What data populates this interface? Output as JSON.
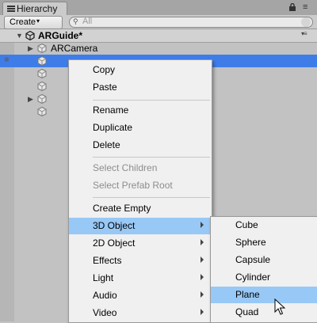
{
  "window": {
    "tab_title": "Hierarchy"
  },
  "toolbar": {
    "create_label": "Create",
    "create_arrow": "▾",
    "search_placeholder": "All",
    "search_icon": "magnifier-icon"
  },
  "scene": {
    "name": "ARGuide*",
    "menu_glyph": "▾≡"
  },
  "tree": {
    "items": [
      {
        "label": "ARCamera",
        "icon": "gameobject-cube-icon",
        "expandable": true
      },
      {
        "label": "",
        "icon": "gameobject-cube-icon",
        "selected": true
      },
      {
        "label": "",
        "icon": "gameobject-cube-icon"
      },
      {
        "label": "",
        "icon": "gameobject-cube-icon"
      },
      {
        "label": "",
        "icon": "gameobject-cube-icon",
        "expandable": true
      },
      {
        "label": "",
        "icon": "gameobject-cube-icon"
      }
    ]
  },
  "context_menu": {
    "items": [
      {
        "label": "Copy"
      },
      {
        "label": "Paste"
      },
      {
        "label": "Rename"
      },
      {
        "label": "Duplicate"
      },
      {
        "label": "Delete"
      },
      {
        "label": "Select Children",
        "disabled": true
      },
      {
        "label": "Select Prefab Root",
        "disabled": true
      },
      {
        "label": "Create Empty"
      },
      {
        "label": "3D Object",
        "submenu": true,
        "highlighted": true
      },
      {
        "label": "2D Object",
        "submenu": true
      },
      {
        "label": "Effects",
        "submenu": true
      },
      {
        "label": "Light",
        "submenu": true
      },
      {
        "label": "Audio",
        "submenu": true
      },
      {
        "label": "Video",
        "submenu": true
      }
    ]
  },
  "submenu_3d_object": {
    "items": [
      {
        "label": "Cube"
      },
      {
        "label": "Sphere"
      },
      {
        "label": "Capsule"
      },
      {
        "label": "Cylinder"
      },
      {
        "label": "Plane",
        "highlighted": true
      },
      {
        "label": "Quad"
      }
    ]
  },
  "colors": {
    "selection": "#3e7de8",
    "menu_highlight": "#98c8f6",
    "disabled_text": "#8d8d8d"
  }
}
